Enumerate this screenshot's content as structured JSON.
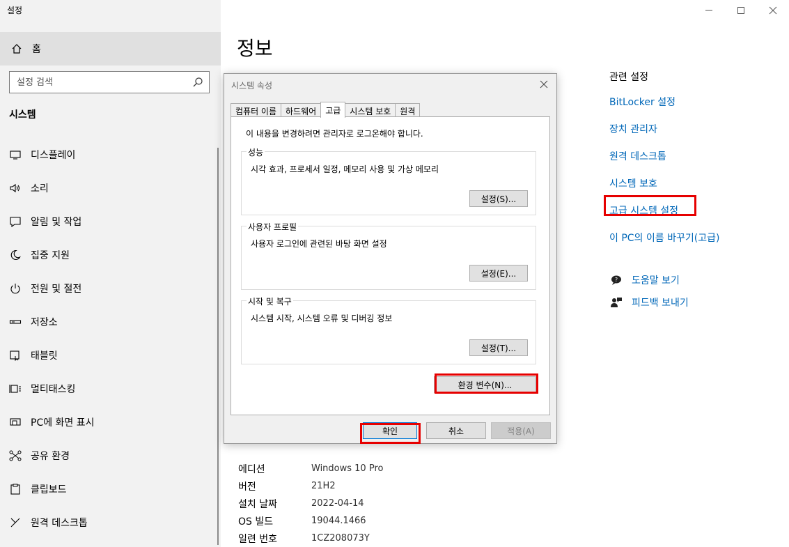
{
  "app": {
    "title": "설정"
  },
  "sidebar": {
    "home_label": "홈",
    "search_placeholder": "설정 검색",
    "section_title": "시스템",
    "items": [
      {
        "label": "디스플레이",
        "icon": "monitor-icon"
      },
      {
        "label": "소리",
        "icon": "speaker-icon"
      },
      {
        "label": "알림 및 작업",
        "icon": "notification-icon"
      },
      {
        "label": "집중 지원",
        "icon": "moon-icon"
      },
      {
        "label": "전원 및 절전",
        "icon": "power-icon"
      },
      {
        "label": "저장소",
        "icon": "storage-icon"
      },
      {
        "label": "태블릿",
        "icon": "tablet-icon"
      },
      {
        "label": "멀티태스킹",
        "icon": "multitasking-icon"
      },
      {
        "label": "PC에 화면 표시",
        "icon": "project-icon"
      },
      {
        "label": "공유 환경",
        "icon": "shared-icon"
      },
      {
        "label": "클립보드",
        "icon": "clipboard-icon"
      },
      {
        "label": "원격 데스크톱",
        "icon": "remote-icon"
      }
    ]
  },
  "main": {
    "title": "정보",
    "specs": [
      {
        "key": "에디션",
        "value": "Windows 10 Pro"
      },
      {
        "key": "버전",
        "value": "21H2"
      },
      {
        "key": "설치 날짜",
        "value": "2022-04-14"
      },
      {
        "key": "OS 빌드",
        "value": "19044.1466"
      },
      {
        "key": "일련 번호",
        "value": "1CZ208073Y"
      }
    ]
  },
  "related": {
    "title": "관련 설정",
    "links": [
      "BitLocker 설정",
      "장치 관리자",
      "원격 데스크톱",
      "시스템 보호",
      "고급 시스템 설정",
      "이 PC의 이름 바꾸기(고급)"
    ]
  },
  "help": {
    "get_help": "도움말 보기",
    "feedback": "피드백 보내기"
  },
  "dialog": {
    "title": "시스템 속성",
    "tabs": [
      "컴퓨터 이름",
      "하드웨어",
      "고급",
      "시스템 보호",
      "원격"
    ],
    "active_tab": "고급",
    "admin_note": "이 내용을 변경하려면 관리자로 로그온해야 합니다.",
    "performance": {
      "label": "성능",
      "desc": "시각 효과, 프로세서 일정, 메모리 사용 및 가상 메모리",
      "button": "설정(S)..."
    },
    "profile": {
      "label": "사용자 프로필",
      "desc": "사용자 로그인에 관련된 바탕 화면 설정",
      "button": "설정(E)..."
    },
    "startup": {
      "label": "시작 및 복구",
      "desc": "시스템 시작, 시스템 오류 및 디버깅 정보",
      "button": "설정(T)..."
    },
    "env_button": "환경 변수(N)...",
    "ok": "확인",
    "cancel": "취소",
    "apply": "적용(A)"
  },
  "colors": {
    "link": "#0067b8",
    "highlight": "#e60000",
    "sidebar_bg": "#f2f2f2"
  }
}
